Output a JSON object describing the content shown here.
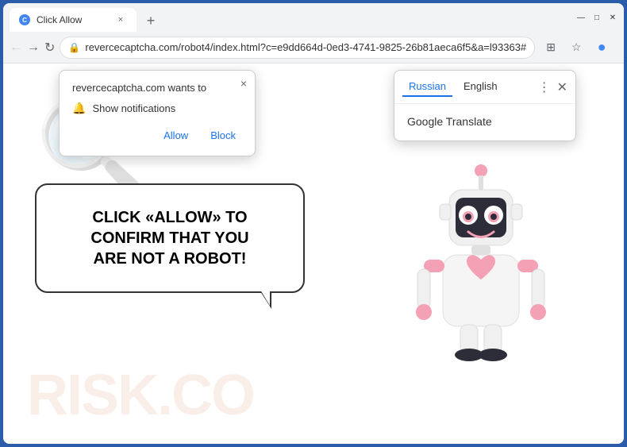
{
  "browser": {
    "tab": {
      "title": "Click Allow",
      "favicon": "C"
    },
    "address": "revercecaptcha.com/robot4/index.html?c=e9dd664d-0ed3-4741-9825-26b81aeca6f5&a=l93363#",
    "nav": {
      "back": "←",
      "forward": "→",
      "refresh": "↻"
    }
  },
  "notification_popup": {
    "title": "revercecaptcha.com wants to",
    "notification_label": "Show notifications",
    "allow_label": "Allow",
    "block_label": "Block",
    "close": "×"
  },
  "translate_popup": {
    "tab_russian": "Russian",
    "tab_english": "English",
    "service_prefix": "Google",
    "service_name": "Translate"
  },
  "page": {
    "main_text_line1": "CLICK «ALLOW» TO CONFIRM THAT YOU",
    "main_text_line2": "ARE NOT A ROBOT!",
    "watermark": "RISK.CO"
  },
  "toolbar_icons": {
    "translate": "⊞",
    "bookmark": "☆",
    "profile": "●",
    "menu": "⋮"
  }
}
